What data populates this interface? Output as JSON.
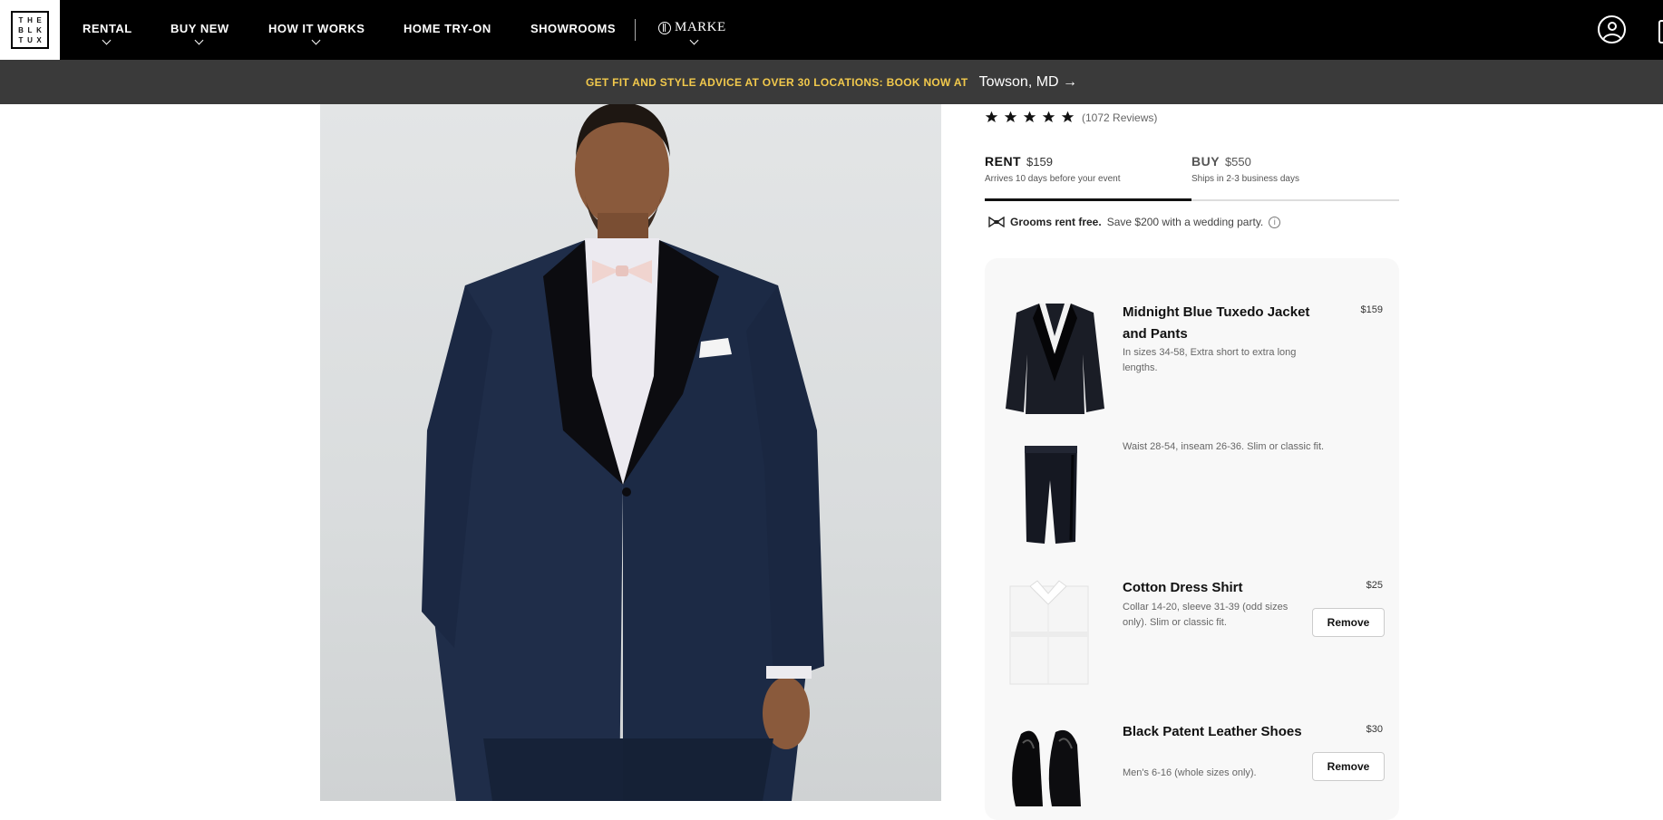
{
  "logo": {
    "letters": [
      "T",
      "H",
      "E",
      "B",
      "L",
      "K",
      "T",
      "U",
      "X"
    ]
  },
  "nav": {
    "items": [
      {
        "label": "RENTAL",
        "dropdown": true
      },
      {
        "label": "BUY NEW",
        "dropdown": true
      },
      {
        "label": "HOW IT WORKS",
        "dropdown": true
      },
      {
        "label": "HOME TRY-ON",
        "dropdown": false
      },
      {
        "label": "SHOWROOMS",
        "dropdown": false
      }
    ],
    "marke_label": "MARKE"
  },
  "promo": {
    "text": "GET FIT AND STYLE ADVICE AT OVER 30 LOCATIONS: BOOK NOW AT",
    "location": "Towson, MD →"
  },
  "product": {
    "rating": 5,
    "reviews": "(1072 Reviews)",
    "tabs": [
      {
        "label": "RENT",
        "price": "$159",
        "sub": "Arrives 10 days before your event",
        "active": true
      },
      {
        "label": "BUY",
        "price": "$550",
        "sub": "Ships in 2-3 business days",
        "active": false
      }
    ],
    "grooms_bold": "Grooms rent free.",
    "grooms_rest": "Save $200 with a wedding party.",
    "items": [
      {
        "name": "Midnight Blue Tuxedo Jacket and Pants",
        "desc": "In sizes 34-58, Extra short to extra long lengths.",
        "price": "$159",
        "remove": ""
      },
      {
        "name": "",
        "desc": "Waist 28-54, inseam 26-36. Slim or classic fit.",
        "price": "",
        "remove": ""
      },
      {
        "name": "Cotton Dress Shirt",
        "desc": "Collar 14-20, sleeve 31-39 (odd sizes only). Slim or classic fit.",
        "price": "$25",
        "remove": "Remove"
      },
      {
        "name": "Black Patent Leather Shoes",
        "desc": "Men's 6-16 (whole sizes only).",
        "price": "$30",
        "remove": "Remove"
      }
    ]
  },
  "colors": {
    "nav_bg": "#000000",
    "promo_bg": "#3a3a3a",
    "promo_accent": "#f2c94c",
    "panel_bg": "#f8f8f8"
  }
}
